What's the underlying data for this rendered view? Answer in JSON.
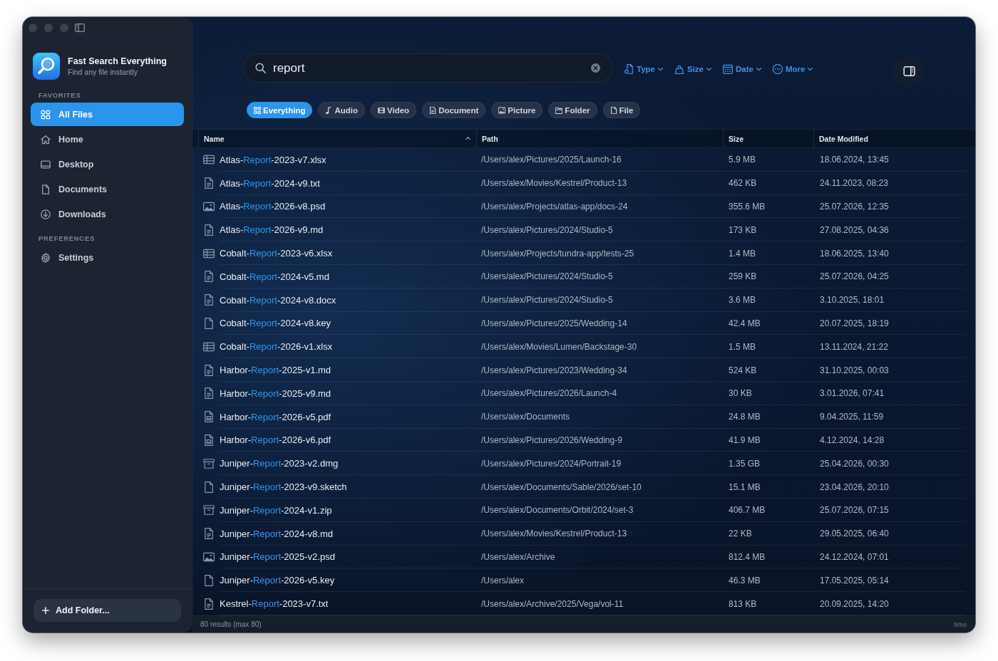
{
  "sidebar": {
    "app": {
      "title": "Fast Search Everything",
      "subtitle": "Find any file instantly"
    },
    "sections": [
      {
        "title": "FAVORITES",
        "items": [
          {
            "label": "All Files",
            "kind": "all",
            "selected": true
          },
          {
            "label": "Home",
            "kind": "home",
            "selected": false
          },
          {
            "label": "Desktop",
            "kind": "desktop",
            "selected": false
          },
          {
            "label": "Documents",
            "kind": "documents",
            "selected": false
          },
          {
            "label": "Downloads",
            "kind": "downloads",
            "selected": false
          }
        ]
      },
      {
        "title": "PREFERENCES",
        "items": [
          {
            "label": "Settings",
            "kind": "settings",
            "selected": false
          }
        ]
      }
    ],
    "add_button": {
      "label": "Add Folder..."
    }
  },
  "search": {
    "value": "report"
  },
  "filters": [
    {
      "label": "Type",
      "kind": "type"
    },
    {
      "label": "Size",
      "kind": "size"
    },
    {
      "label": "Date",
      "kind": "date"
    },
    {
      "label": "More",
      "kind": "more"
    }
  ],
  "categories": [
    {
      "label": "Everything",
      "kind": "everything",
      "selected": true
    },
    {
      "label": "Audio",
      "kind": "audio",
      "selected": false
    },
    {
      "label": "Video",
      "kind": "video",
      "selected": false
    },
    {
      "label": "Document",
      "kind": "document",
      "selected": false
    },
    {
      "label": "Picture",
      "kind": "picture",
      "selected": false
    },
    {
      "label": "Folder",
      "kind": "folder",
      "selected": false
    },
    {
      "label": "File",
      "kind": "file",
      "selected": false
    }
  ],
  "table": {
    "columns": [
      {
        "label": "Name",
        "sorted": true
      },
      {
        "label": "Path",
        "sorted": false
      },
      {
        "label": "Size",
        "sorted": false
      },
      {
        "label": "Date Modified",
        "sorted": false
      }
    ],
    "rows": [
      {
        "kind": "spreadsheet",
        "name": {
          "prefix": "Atlas-",
          "match": "Report",
          "suffix": "-2023-v7.xlsx"
        },
        "path": "/Users/alex/Pictures/2025/Launch-16",
        "size": "5.9 MB",
        "modified": "18.06.2024, 13:45"
      },
      {
        "kind": "text",
        "name": {
          "prefix": "Atlas-",
          "match": "Report",
          "suffix": "-2024-v9.txt"
        },
        "path": "/Users/alex/Movies/Kestrel/Product-13",
        "size": "462 KB",
        "modified": "24.11.2023, 08:23"
      },
      {
        "kind": "image",
        "name": {
          "prefix": "Atlas-",
          "match": "Report",
          "suffix": "-2026-v8.psd"
        },
        "path": "/Users/alex/Projects/atlas-app/docs-24",
        "size": "355.6 MB",
        "modified": "25.07.2026, 12:35"
      },
      {
        "kind": "text",
        "name": {
          "prefix": "Atlas-",
          "match": "Report",
          "suffix": "-2026-v9.md"
        },
        "path": "/Users/alex/Pictures/2024/Studio-5",
        "size": "173 KB",
        "modified": "27.08.2025, 04:36"
      },
      {
        "kind": "spreadsheet",
        "name": {
          "prefix": "Cobalt-",
          "match": "Report",
          "suffix": "-2023-v6.xlsx"
        },
        "path": "/Users/alex/Projects/tundra-app/tests-25",
        "size": "1.4 MB",
        "modified": "18.06.2025, 13:40"
      },
      {
        "kind": "text",
        "name": {
          "prefix": "Cobalt-",
          "match": "Report",
          "suffix": "-2024-v5.md"
        },
        "path": "/Users/alex/Pictures/2024/Studio-5",
        "size": "259 KB",
        "modified": "25.07.2026, 04:25"
      },
      {
        "kind": "text",
        "name": {
          "prefix": "Cobalt-",
          "match": "Report",
          "suffix": "-2024-v8.docx"
        },
        "path": "/Users/alex/Pictures/2024/Studio-5",
        "size": "3.6 MB",
        "modified": "3.10.2025, 18:01"
      },
      {
        "kind": "file",
        "name": {
          "prefix": "Cobalt-",
          "match": "Report",
          "suffix": "-2024-v8.key"
        },
        "path": "/Users/alex/Pictures/2025/Wedding-14",
        "size": "42.4 MB",
        "modified": "20.07.2025, 18:19"
      },
      {
        "kind": "spreadsheet",
        "name": {
          "prefix": "Cobalt-",
          "match": "Report",
          "suffix": "-2026-v1.xlsx"
        },
        "path": "/Users/alex/Movies/Lumen/Backstage-30",
        "size": "1.5 MB",
        "modified": "13.11.2024, 21:22"
      },
      {
        "kind": "text",
        "name": {
          "prefix": "Harbor-",
          "match": "Report",
          "suffix": "-2025-v1.md"
        },
        "path": "/Users/alex/Pictures/2023/Wedding-34",
        "size": "524 KB",
        "modified": "31.10.2025, 00:03"
      },
      {
        "kind": "text",
        "name": {
          "prefix": "Harbor-",
          "match": "Report",
          "suffix": "-2025-v9.md"
        },
        "path": "/Users/alex/Pictures/2026/Launch-4",
        "size": "30 KB",
        "modified": "3.01.2026, 07:41"
      },
      {
        "kind": "pdf",
        "name": {
          "prefix": "Harbor-",
          "match": "Report",
          "suffix": "-2026-v5.pdf"
        },
        "path": "/Users/alex/Documents",
        "size": "24.8 MB",
        "modified": "9.04.2025, 11:59"
      },
      {
        "kind": "pdf",
        "name": {
          "prefix": "Harbor-",
          "match": "Report",
          "suffix": "-2026-v6.pdf"
        },
        "path": "/Users/alex/Pictures/2026/Wedding-9",
        "size": "41.9 MB",
        "modified": "4.12.2024, 14:28"
      },
      {
        "kind": "archive",
        "name": {
          "prefix": "Juniper-",
          "match": "Report",
          "suffix": "-2023-v2.dmg"
        },
        "path": "/Users/alex/Pictures/2024/Portrait-19",
        "size": "1.35 GB",
        "modified": "25.04.2026, 00:30"
      },
      {
        "kind": "file",
        "name": {
          "prefix": "Juniper-",
          "match": "Report",
          "suffix": "-2023-v9.sketch"
        },
        "path": "/Users/alex/Documents/Sable/2026/set-10",
        "size": "15.1 MB",
        "modified": "23.04.2026, 20:10"
      },
      {
        "kind": "archive",
        "name": {
          "prefix": "Juniper-",
          "match": "Report",
          "suffix": "-2024-v1.zip"
        },
        "path": "/Users/alex/Documents/Orbit/2024/set-3",
        "size": "406.7 MB",
        "modified": "25.07.2026, 07:15"
      },
      {
        "kind": "text",
        "name": {
          "prefix": "Juniper-",
          "match": "Report",
          "suffix": "-2024-v8.md"
        },
        "path": "/Users/alex/Movies/Kestrel/Product-13",
        "size": "22 KB",
        "modified": "29.05.2025, 06:40"
      },
      {
        "kind": "image",
        "name": {
          "prefix": "Juniper-",
          "match": "Report",
          "suffix": "-2025-v2.psd"
        },
        "path": "/Users/alex/Archive",
        "size": "812.4 MB",
        "modified": "24.12.2024, 07:01"
      },
      {
        "kind": "file",
        "name": {
          "prefix": "Juniper-",
          "match": "Report",
          "suffix": "-2026-v5.key"
        },
        "path": "/Users/alex",
        "size": "46.3 MB",
        "modified": "17.05.2025, 05:14"
      },
      {
        "kind": "text",
        "name": {
          "prefix": "Kestrel-",
          "match": "Report",
          "suffix": "-2023-v7.txt"
        },
        "path": "/Users/alex/Archive/2025/Vega/vol-11",
        "size": "813 KB",
        "modified": "20.09.2025, 14:20"
      }
    ]
  },
  "status_bar": {
    "results": "80 results (max 80)",
    "timing": "5ms"
  }
}
